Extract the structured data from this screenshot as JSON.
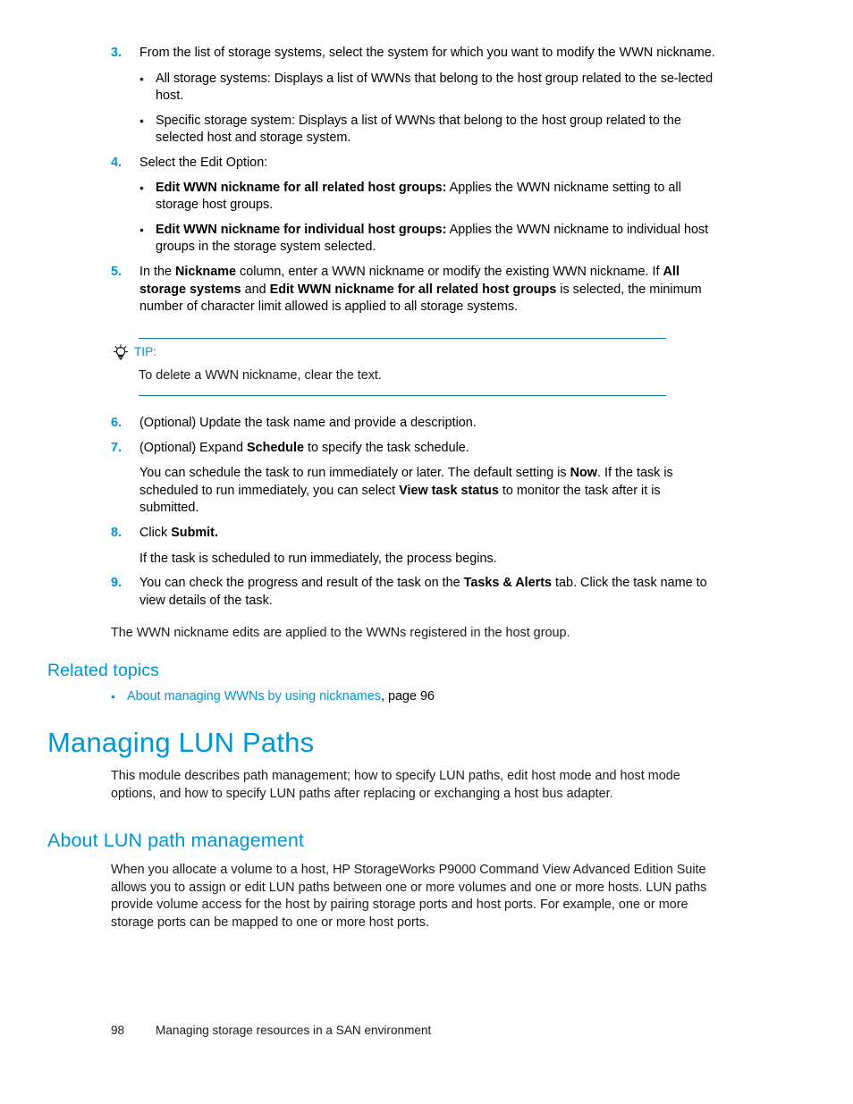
{
  "page": {
    "number": "98",
    "footer_title": "Managing storage resources in a SAN environment",
    "accent_color": "#0096d6",
    "rule_color": "#0b7ab8"
  },
  "steps_upper": [
    {
      "number": "3.",
      "text": "From the list of storage systems, select the system for which you want to modify the WWN nickname.",
      "bullets": [
        {
          "lead": "",
          "text": "All storage systems: Displays a list of WWNs that belong to the host group related to the se-lected host."
        },
        {
          "lead": "",
          "text": "Specific storage system: Displays a list of WWNs that belong to the host group related to the selected host and storage system."
        }
      ]
    },
    {
      "number": "4.",
      "text": "Select the Edit Option:",
      "bullets": [
        {
          "lead": "Edit WWN nickname for all related host groups:",
          "text": " Applies the WWN nickname setting to all storage host groups."
        },
        {
          "lead": "Edit WWN nickname for individual host groups:",
          "text": " Applies the WWN nickname to individual host groups in the storage system selected."
        }
      ]
    }
  ],
  "step5": {
    "number": "5.",
    "part1": "In the ",
    "bold1": "Nickname",
    "part2": " column, enter a WWN nickname or modify the existing WWN nickname. If ",
    "bold2": "All storage systems",
    "part3": " and ",
    "bold3": "Edit WWN nickname for all related host groups",
    "part4": " is selected, the minimum number of character limit allowed is applied to all storage systems."
  },
  "tip": {
    "icon": "lightbulb-icon",
    "label": "TIP:",
    "text": "To delete a WWN nickname, clear the text."
  },
  "step6": {
    "number": "6.",
    "text": "(Optional) Update the task name and provide a description."
  },
  "step7": {
    "number": "7.",
    "part1": "(Optional) Expand ",
    "bold1": "Schedule",
    "part2": " to specify the task schedule.",
    "para_part1": "You can schedule the task to run immediately or later. The default setting is ",
    "para_bold1": "Now",
    "para_part2": ". If the task is scheduled to run immediately, you can select ",
    "para_bold2": "View task status",
    "para_part3": " to monitor the task after it is submitted."
  },
  "step8": {
    "number": "8.",
    "part1": "Click ",
    "bold1": "Submit.",
    "para": "If the task is scheduled to run immediately, the process begins."
  },
  "step9": {
    "number": "9.",
    "part1": "You can check the progress and result of the task on the ",
    "bold1": "Tasks & Alerts",
    "part2": " tab. Click the task name to view details of the task."
  },
  "closing_paragraph": "The WWN nickname edits are applied to the WWNs registered in the host group.",
  "related": {
    "heading": "Related topics",
    "items": [
      {
        "link_text": "About managing WWNs by using nicknames",
        "suffix": ", page 96"
      }
    ]
  },
  "chapter": {
    "heading": "Managing LUN Paths",
    "body": "This module describes path management; how to specify LUN paths, edit host mode and host mode options, and how to specify LUN paths after replacing or exchanging a host bus adapter."
  },
  "section": {
    "heading": "About LUN path management",
    "body": "When you allocate a volume to a host, HP StorageWorks P9000 Command View Advanced Edition Suite allows you to assign or edit LUN paths between one or more volumes and one or more hosts. LUN paths provide volume access for the host by pairing storage ports and host ports. For example, one or more storage ports can be mapped to one or more host ports."
  }
}
